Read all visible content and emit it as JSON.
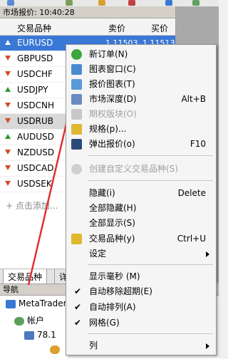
{
  "market_watch": {
    "title": "市场报价: 10:40:28",
    "col_symbol": "交易品种",
    "col_bid": "卖价",
    "col_ask": "买价",
    "rows": [
      {
        "symbol": "EURUSD",
        "bid": "1.11503",
        "ask": "1.11513",
        "dir": "up"
      },
      {
        "symbol": "GBPUSD",
        "bid": "",
        "ask": "",
        "dir": "down"
      },
      {
        "symbol": "USDCHF",
        "bid": "",
        "ask": "",
        "dir": "down"
      },
      {
        "symbol": "USDJPY",
        "bid": "",
        "ask": "",
        "dir": "up"
      },
      {
        "symbol": "USDCNH",
        "bid": "",
        "ask": "",
        "dir": "down"
      },
      {
        "symbol": "USDRUB",
        "bid": "",
        "ask": "",
        "dir": "down"
      },
      {
        "symbol": "AUDUSD",
        "bid": "",
        "ask": "",
        "dir": "up"
      },
      {
        "symbol": "NZDUSD",
        "bid": "",
        "ask": "",
        "dir": "down"
      },
      {
        "symbol": "USDCAD",
        "bid": "",
        "ask": "",
        "dir": "down"
      },
      {
        "symbol": "USDSEK",
        "bid": "",
        "ask": "",
        "dir": "down"
      }
    ],
    "add_label": "点击添加...",
    "tab_symbols": "交易品种",
    "tab_other": "详"
  },
  "navigator": {
    "title": "导航",
    "root": "MetaTrader",
    "accounts": "帐户",
    "account_num": "78.1"
  },
  "context_menu": {
    "new_order": "新订单(N)",
    "chart_window": "图表窗口(C)",
    "tick_chart": "报价图表(T)",
    "depth": "市场深度(D)",
    "depth_shortcut": "Alt+B",
    "options_board": "期权版块(O)",
    "spec": "规格(p)...",
    "popup_prices": "弹出报价(o)",
    "popup_shortcut": "F10",
    "custom_symbol": "创建自定义交易品种(S)",
    "hide": "隐藏(i)",
    "hide_shortcut": "Delete",
    "hide_all": "全部隐藏(H)",
    "show_all": "全部显示(S)",
    "symbols": "交易品种(y)",
    "symbols_shortcut": "Ctrl+U",
    "sets": "设定",
    "milliseconds": "显示毫秒 (M)",
    "auto_remove": "自动移除超期(E)",
    "auto_arrange": "自动排列(A)",
    "grid": "网格(G)",
    "columns": "列"
  },
  "colors": {
    "selection": "#3a78d6",
    "price": "#1e5fb3",
    "annotation_arrow": "#e03030"
  }
}
